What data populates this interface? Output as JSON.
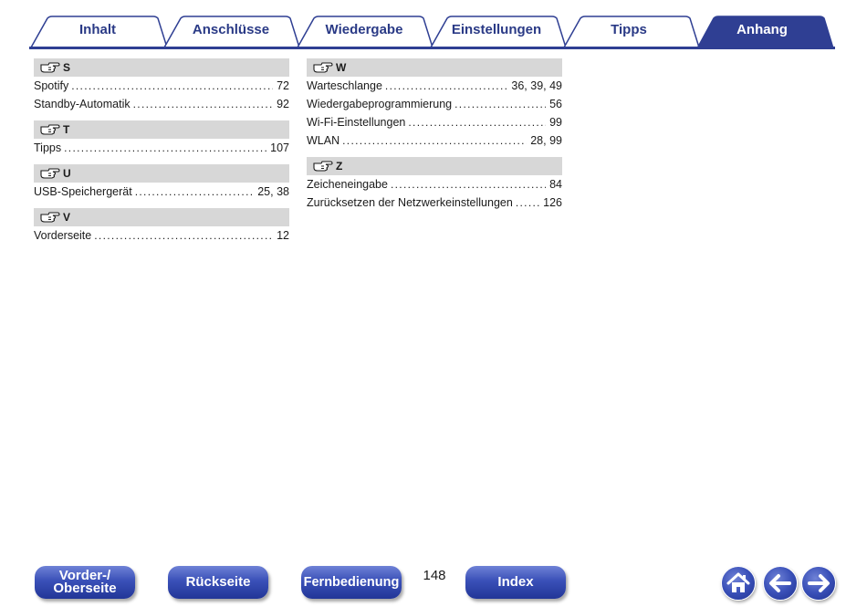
{
  "tabs": [
    {
      "label": "Inhalt",
      "active": false
    },
    {
      "label": "Anschlüsse",
      "active": false
    },
    {
      "label": "Wiedergabe",
      "active": false
    },
    {
      "label": "Einstellungen",
      "active": false
    },
    {
      "label": "Tipps",
      "active": false
    },
    {
      "label": "Anhang",
      "active": true
    }
  ],
  "index": {
    "left": [
      {
        "letter": "S",
        "entries": [
          {
            "term": "Spotify",
            "pages": "72"
          },
          {
            "term": "Standby-Automatik",
            "pages": "92"
          }
        ]
      },
      {
        "letter": "T",
        "entries": [
          {
            "term": "Tipps",
            "pages": "107"
          }
        ]
      },
      {
        "letter": "U",
        "entries": [
          {
            "term": "USB-Speichergerät",
            "pages": "25, 38"
          }
        ]
      },
      {
        "letter": "V",
        "entries": [
          {
            "term": "Vorderseite",
            "pages": "12"
          }
        ]
      }
    ],
    "right": [
      {
        "letter": "W",
        "entries": [
          {
            "term": "Warteschlange",
            "pages": "36, 39, 49"
          },
          {
            "term": "Wiedergabeprogrammierung",
            "pages": "56"
          },
          {
            "term": "Wi-Fi-Einstellungen",
            "pages": "99"
          },
          {
            "term": "WLAN",
            "pages": "28, 99"
          }
        ]
      },
      {
        "letter": "Z",
        "entries": [
          {
            "term": "Zeicheneingabe",
            "pages": "84"
          },
          {
            "term": "Zurücksetzen der Netzwerkeinstellungen",
            "pages": "126"
          }
        ]
      }
    ]
  },
  "nav": {
    "vorder_line1": "Vorder-/",
    "vorder_line2": "Oberseite",
    "rueckseite": "Rückseite",
    "fernbedienung": "Fernbedienung",
    "index": "Index",
    "page_number": "148"
  },
  "icons": {
    "section_marker": "pointing-hand-icon",
    "home": "home-icon",
    "back": "arrow-left-icon",
    "forward": "arrow-right-icon"
  },
  "colors": {
    "tab_text": "#2a3a86",
    "active_tab": "#2f3f93",
    "button_blue": "#3a50b8",
    "section_bg": "#d7d7d7"
  }
}
